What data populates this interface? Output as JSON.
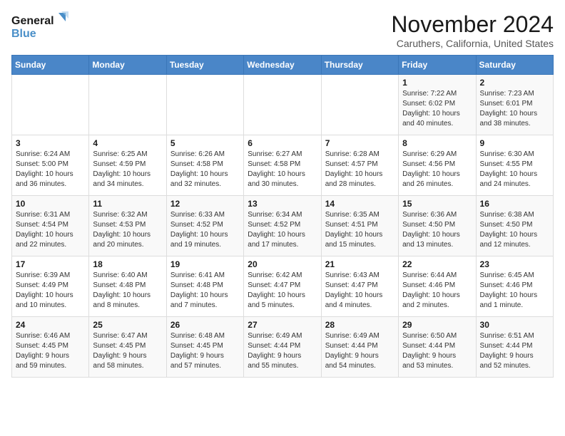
{
  "app": {
    "name1": "General",
    "name2": "Blue"
  },
  "calendar": {
    "month": "November 2024",
    "location": "Caruthers, California, United States",
    "weekdays": [
      "Sunday",
      "Monday",
      "Tuesday",
      "Wednesday",
      "Thursday",
      "Friday",
      "Saturday"
    ],
    "weeks": [
      [
        {
          "day": "",
          "info": ""
        },
        {
          "day": "",
          "info": ""
        },
        {
          "day": "",
          "info": ""
        },
        {
          "day": "",
          "info": ""
        },
        {
          "day": "",
          "info": ""
        },
        {
          "day": "1",
          "info": "Sunrise: 7:22 AM\nSunset: 6:02 PM\nDaylight: 10 hours\nand 40 minutes."
        },
        {
          "day": "2",
          "info": "Sunrise: 7:23 AM\nSunset: 6:01 PM\nDaylight: 10 hours\nand 38 minutes."
        }
      ],
      [
        {
          "day": "3",
          "info": "Sunrise: 6:24 AM\nSunset: 5:00 PM\nDaylight: 10 hours\nand 36 minutes."
        },
        {
          "day": "4",
          "info": "Sunrise: 6:25 AM\nSunset: 4:59 PM\nDaylight: 10 hours\nand 34 minutes."
        },
        {
          "day": "5",
          "info": "Sunrise: 6:26 AM\nSunset: 4:58 PM\nDaylight: 10 hours\nand 32 minutes."
        },
        {
          "day": "6",
          "info": "Sunrise: 6:27 AM\nSunset: 4:58 PM\nDaylight: 10 hours\nand 30 minutes."
        },
        {
          "day": "7",
          "info": "Sunrise: 6:28 AM\nSunset: 4:57 PM\nDaylight: 10 hours\nand 28 minutes."
        },
        {
          "day": "8",
          "info": "Sunrise: 6:29 AM\nSunset: 4:56 PM\nDaylight: 10 hours\nand 26 minutes."
        },
        {
          "day": "9",
          "info": "Sunrise: 6:30 AM\nSunset: 4:55 PM\nDaylight: 10 hours\nand 24 minutes."
        }
      ],
      [
        {
          "day": "10",
          "info": "Sunrise: 6:31 AM\nSunset: 4:54 PM\nDaylight: 10 hours\nand 22 minutes."
        },
        {
          "day": "11",
          "info": "Sunrise: 6:32 AM\nSunset: 4:53 PM\nDaylight: 10 hours\nand 20 minutes."
        },
        {
          "day": "12",
          "info": "Sunrise: 6:33 AM\nSunset: 4:52 PM\nDaylight: 10 hours\nand 19 minutes."
        },
        {
          "day": "13",
          "info": "Sunrise: 6:34 AM\nSunset: 4:52 PM\nDaylight: 10 hours\nand 17 minutes."
        },
        {
          "day": "14",
          "info": "Sunrise: 6:35 AM\nSunset: 4:51 PM\nDaylight: 10 hours\nand 15 minutes."
        },
        {
          "day": "15",
          "info": "Sunrise: 6:36 AM\nSunset: 4:50 PM\nDaylight: 10 hours\nand 13 minutes."
        },
        {
          "day": "16",
          "info": "Sunrise: 6:38 AM\nSunset: 4:50 PM\nDaylight: 10 hours\nand 12 minutes."
        }
      ],
      [
        {
          "day": "17",
          "info": "Sunrise: 6:39 AM\nSunset: 4:49 PM\nDaylight: 10 hours\nand 10 minutes."
        },
        {
          "day": "18",
          "info": "Sunrise: 6:40 AM\nSunset: 4:48 PM\nDaylight: 10 hours\nand 8 minutes."
        },
        {
          "day": "19",
          "info": "Sunrise: 6:41 AM\nSunset: 4:48 PM\nDaylight: 10 hours\nand 7 minutes."
        },
        {
          "day": "20",
          "info": "Sunrise: 6:42 AM\nSunset: 4:47 PM\nDaylight: 10 hours\nand 5 minutes."
        },
        {
          "day": "21",
          "info": "Sunrise: 6:43 AM\nSunset: 4:47 PM\nDaylight: 10 hours\nand 4 minutes."
        },
        {
          "day": "22",
          "info": "Sunrise: 6:44 AM\nSunset: 4:46 PM\nDaylight: 10 hours\nand 2 minutes."
        },
        {
          "day": "23",
          "info": "Sunrise: 6:45 AM\nSunset: 4:46 PM\nDaylight: 10 hours\nand 1 minute."
        }
      ],
      [
        {
          "day": "24",
          "info": "Sunrise: 6:46 AM\nSunset: 4:45 PM\nDaylight: 9 hours\nand 59 minutes."
        },
        {
          "day": "25",
          "info": "Sunrise: 6:47 AM\nSunset: 4:45 PM\nDaylight: 9 hours\nand 58 minutes."
        },
        {
          "day": "26",
          "info": "Sunrise: 6:48 AM\nSunset: 4:45 PM\nDaylight: 9 hours\nand 57 minutes."
        },
        {
          "day": "27",
          "info": "Sunrise: 6:49 AM\nSunset: 4:44 PM\nDaylight: 9 hours\nand 55 minutes."
        },
        {
          "day": "28",
          "info": "Sunrise: 6:49 AM\nSunset: 4:44 PM\nDaylight: 9 hours\nand 54 minutes."
        },
        {
          "day": "29",
          "info": "Sunrise: 6:50 AM\nSunset: 4:44 PM\nDaylight: 9 hours\nand 53 minutes."
        },
        {
          "day": "30",
          "info": "Sunrise: 6:51 AM\nSunset: 4:44 PM\nDaylight: 9 hours\nand 52 minutes."
        }
      ]
    ]
  }
}
